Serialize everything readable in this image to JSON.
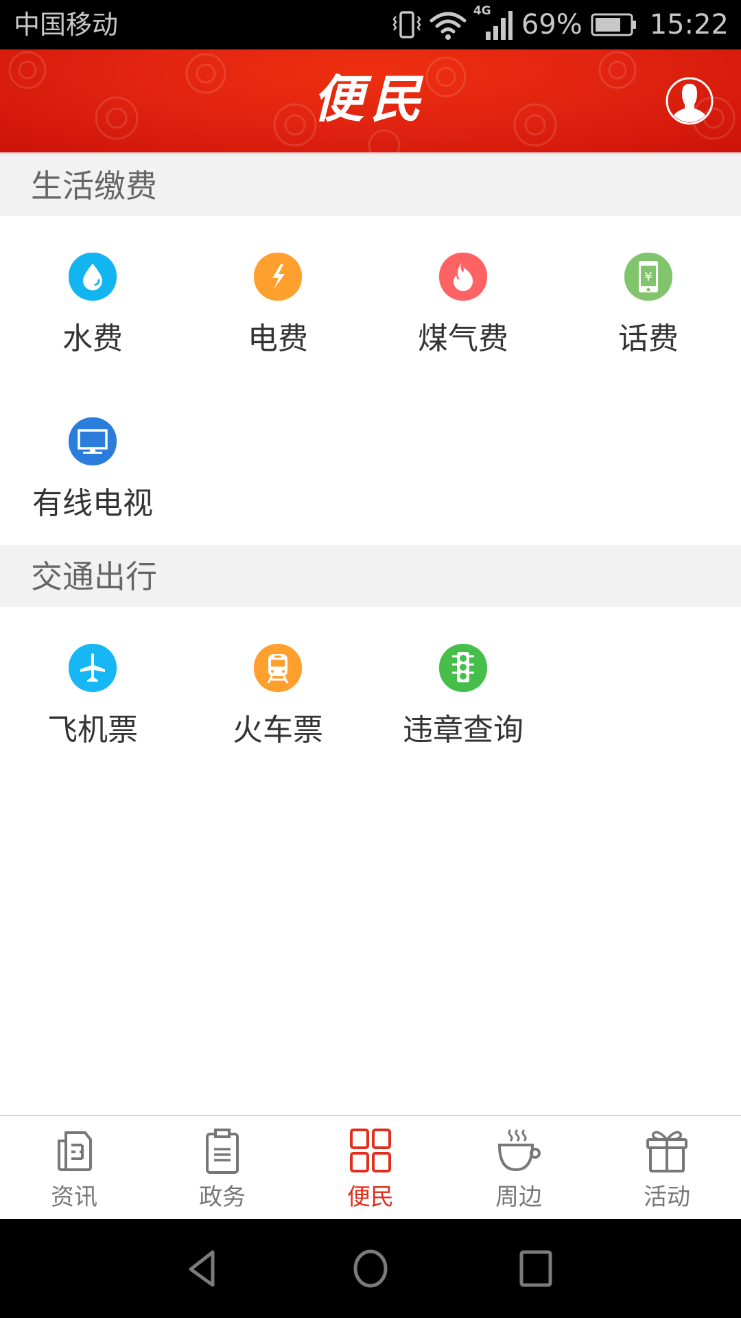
{
  "status_bar": {
    "carrier": "中国移动",
    "network": "4G",
    "battery_percent": "69%",
    "battery_level": 0.69,
    "time": "15:22",
    "icons": [
      "vibrate-icon",
      "wifi-icon",
      "signal-icon",
      "battery-icon"
    ]
  },
  "header": {
    "title": "便民",
    "avatar_icon": "user-profile-icon",
    "background_color": "#e02310"
  },
  "sections": [
    {
      "title": "生活缴费",
      "items": [
        {
          "label": "水费",
          "icon": "water-drop-icon",
          "color": "#13b5f1"
        },
        {
          "label": "电费",
          "icon": "lightning-icon",
          "color": "#ff9f2e"
        },
        {
          "label": "煤气费",
          "icon": "flame-icon",
          "color": "#ff6262"
        },
        {
          "label": "话费",
          "icon": "phone-yuan-icon",
          "color": "#80c46b"
        },
        {
          "label": "有线电视",
          "icon": "tv-icon",
          "color": "#2b7ddb"
        }
      ]
    },
    {
      "title": "交通出行",
      "items": [
        {
          "label": "飞机票",
          "icon": "airplane-icon",
          "color": "#16b7f4"
        },
        {
          "label": "火车票",
          "icon": "train-icon",
          "color": "#ff9f2e"
        },
        {
          "label": "违章查询",
          "icon": "traffic-light-icon",
          "color": "#45bf4a"
        }
      ]
    }
  ],
  "tab_bar": {
    "active_color": "#e02e1c",
    "inactive_color": "#777777",
    "tabs": [
      {
        "label": "资讯",
        "icon": "newspaper-icon",
        "active": false
      },
      {
        "label": "政务",
        "icon": "clipboard-icon",
        "active": false
      },
      {
        "label": "便民",
        "icon": "grid-icon",
        "active": true
      },
      {
        "label": "周边",
        "icon": "coffee-cup-icon",
        "active": false
      },
      {
        "label": "活动",
        "icon": "gift-icon",
        "active": false
      }
    ]
  },
  "system_nav": {
    "buttons": [
      "back-icon",
      "home-icon",
      "recents-icon"
    ]
  }
}
